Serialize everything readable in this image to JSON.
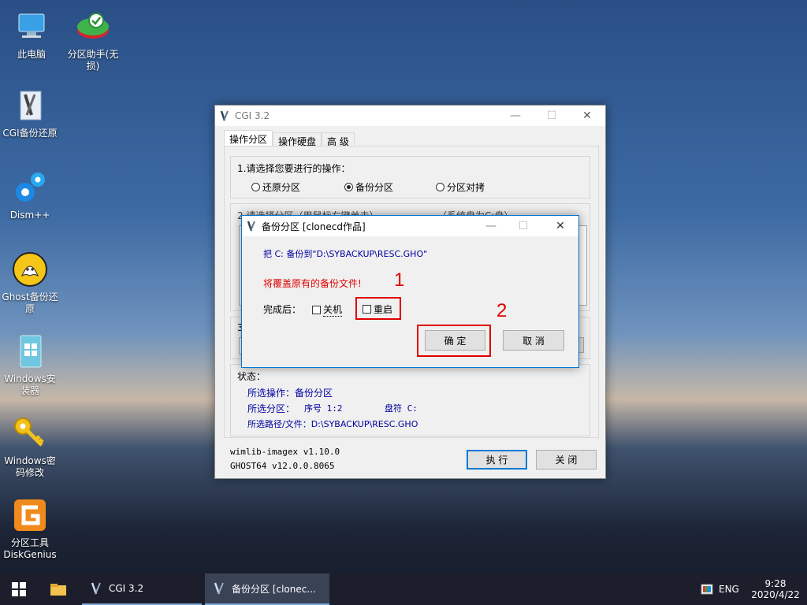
{
  "desktop": {
    "icons": [
      {
        "label": "此电脑"
      },
      {
        "label": "分区助手(无损)"
      },
      {
        "label": "CGI备份还原"
      },
      {
        "label": "Dism++"
      },
      {
        "label": "Ghost备份还原"
      },
      {
        "label": "Windows安装器"
      },
      {
        "label": "Windows密码修改"
      },
      {
        "label": "分区工具\nDiskGenius"
      }
    ]
  },
  "cgi_window": {
    "title": "CGI 3.2",
    "tabs": [
      "操作分区",
      "操作硬盘",
      "高 级"
    ],
    "step1_label": "1.请选择您要进行的操作：",
    "radios": [
      {
        "label": "还原分区",
        "checked": false
      },
      {
        "label": "备份分区",
        "checked": true
      },
      {
        "label": "分区对拷",
        "checked": false
      }
    ],
    "step2_label": "2.请选择分区（用鼠标右键单击）",
    "step2_hint": "（系统盘为C:盘）",
    "step3_label": "3",
    "status": {
      "title": "状态：",
      "operation": "所选操作：备份分区",
      "partition_label": "所选分区：",
      "partition_seq": "序号 1:2",
      "partition_drive": "盘符 C:",
      "path": "所选路径/文件：D:\\SYBACKUP\\RESC.GHO"
    },
    "version1": "wimlib-imagex v1.10.0",
    "version2": "GHOST64 v12.0.0.8065",
    "execute_label": "执 行",
    "close_label": "关 闭"
  },
  "dialog": {
    "title": "备份分区  [clonecd作品]",
    "message": "把 C: 备份到\"D:\\SYBACKUP\\RESC.GHO\"",
    "warning": "将覆盖原有的备份文件!",
    "after_label": "完成后：",
    "shutdown_label": "关机",
    "restart_label": "重启",
    "ok_label": "确 定",
    "cancel_label": "取 消"
  },
  "annotations": {
    "one": "1",
    "two": "2"
  },
  "taskbar": {
    "task1": "CGI 3.2",
    "task2": "备份分区  [clonec...",
    "lang": "ENG",
    "time": "9:28",
    "date": "2020/4/22"
  },
  "colors": {
    "accent": "#0078d7",
    "warning": "#e00000",
    "link_blue": "#0000a0"
  }
}
